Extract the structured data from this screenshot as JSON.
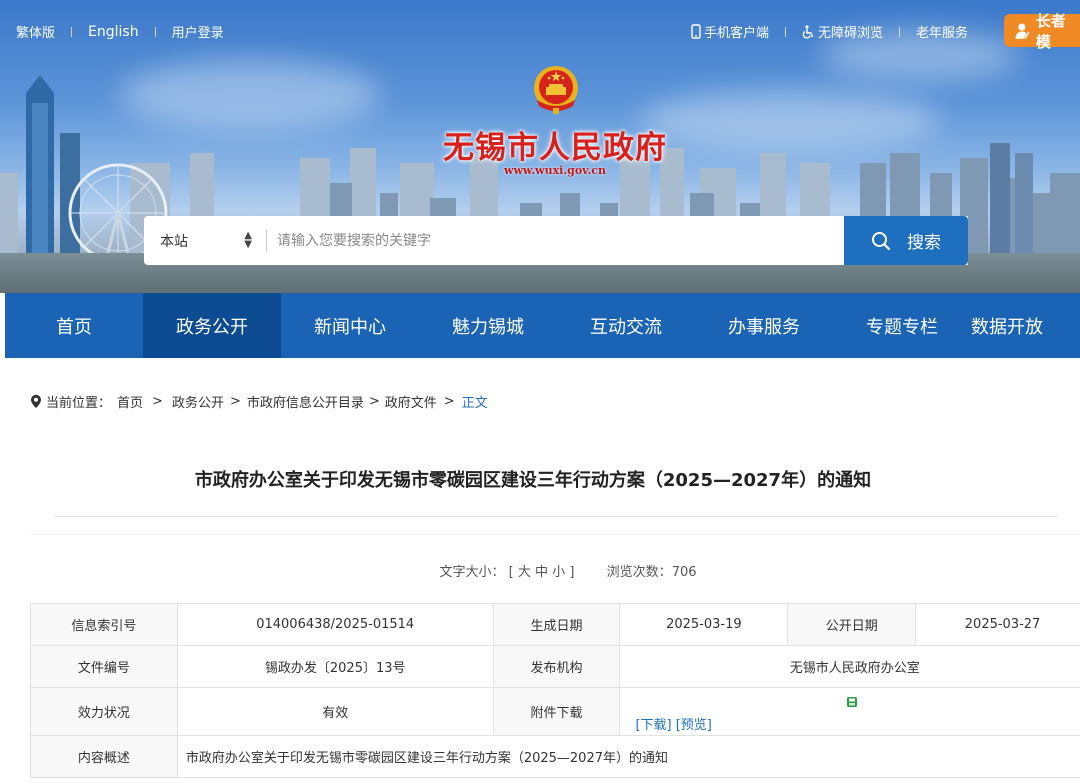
{
  "topbar": {
    "traditional": "繁体版",
    "english": "English",
    "login": "用户登录",
    "mobile": "手机客户端",
    "accessible": "无障碍浏览",
    "elderly": "老年服务",
    "elder_mode": "长者模"
  },
  "header": {
    "site_title": "无锡市人民政府",
    "site_url": "www.wuxi.gov.cn"
  },
  "search": {
    "scope": "本站",
    "placeholder": "请输入您要搜索的关键字",
    "button": "搜索"
  },
  "nav": {
    "items": [
      {
        "label": "首页"
      },
      {
        "label": "政务公开"
      },
      {
        "label": "新闻中心"
      },
      {
        "label": "魅力锡城"
      },
      {
        "label": "互动交流"
      },
      {
        "label": "办事服务"
      },
      {
        "label": "专题专栏"
      },
      {
        "label": "数据开放"
      }
    ]
  },
  "breadcrumb": {
    "prefix": "当前位置：",
    "items": [
      "首页",
      "政务公开",
      "市政府信息公开目录",
      "政府文件",
      "正文"
    ]
  },
  "article": {
    "title": "市政府办公室关于印发无锡市零碳园区建设三年行动方案（2025—2027年）的通知",
    "font_size_label": "文字大小：",
    "font_size_open": "[",
    "font_large": "大",
    "font_medium": "中",
    "font_small": "小",
    "font_size_close": "]",
    "views_label": "浏览次数：",
    "views": "706"
  },
  "info": {
    "index_label": "信息索引号",
    "index_value": "014006438/2025-01514",
    "created_label": "生成日期",
    "created_value": "2025-03-19",
    "published_label": "公开日期",
    "published_value": "2025-03-27",
    "doc_no_label": "文件编号",
    "doc_no_value": "锡政办发〔2025〕13号",
    "issuer_label": "发布机构",
    "issuer_value": "无锡市人民政府办公室",
    "status_label": "效力状况",
    "status_value": "有效",
    "attachment_label": "附件下载",
    "download": "[下载]",
    "preview": "[预览]",
    "summary_label": "内容概述",
    "summary_value": "市政府办公室关于印发无锡市零碳园区建设三年行动方案（2025—2027年）的通知"
  },
  "colors": {
    "nav_blue": "#1b64b5",
    "nav_active": "#0d4b93",
    "title_red": "#d8201d",
    "accent_orange": "#f08a24",
    "link_blue": "#1f6fc0"
  }
}
